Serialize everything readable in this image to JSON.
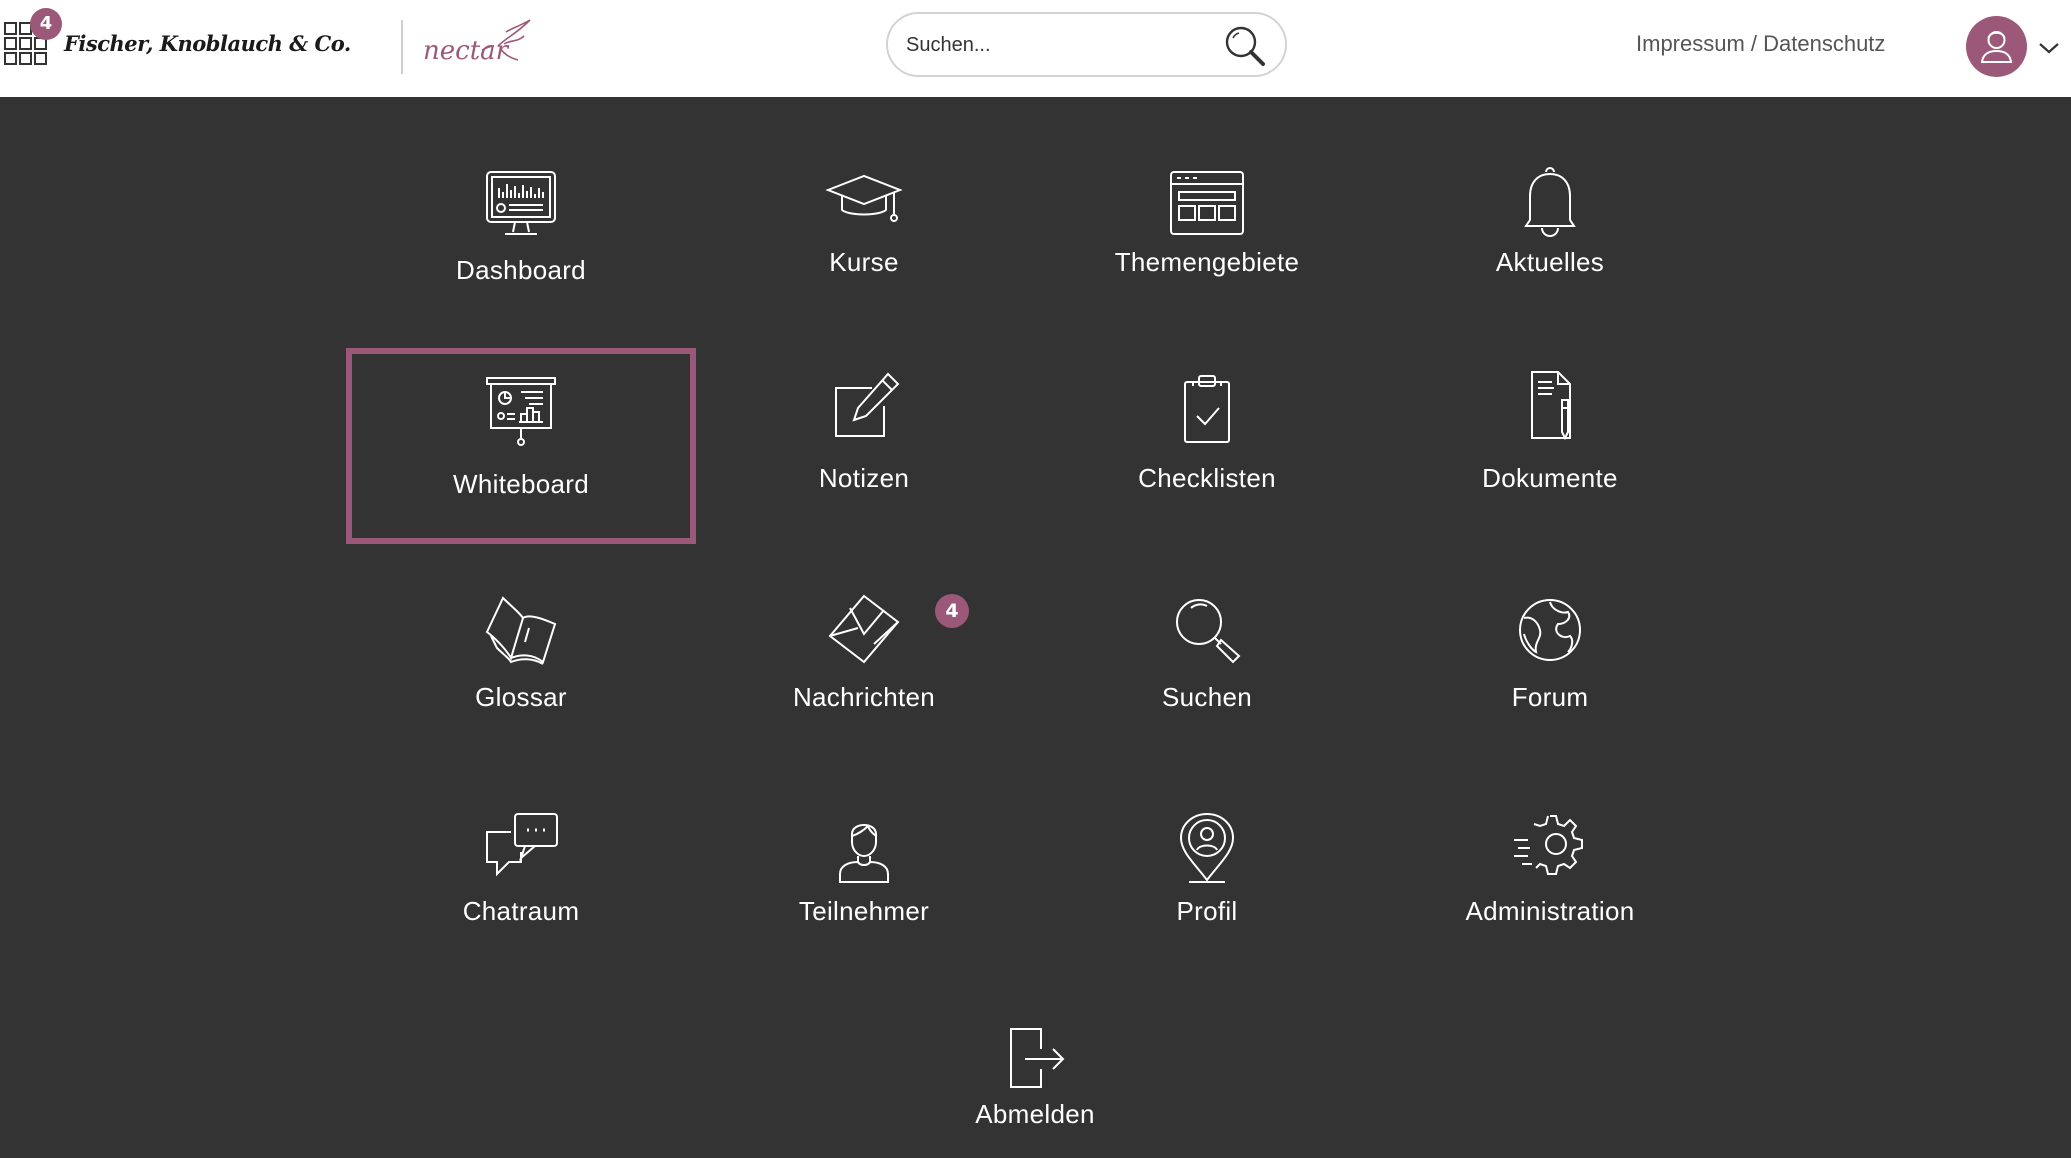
{
  "header": {
    "app_badge_count": "4",
    "brand_name": "Fischer, Knoblauch & Co.",
    "nectar_logo_text": "nectar",
    "search_placeholder": "Suchen...",
    "impressum_link": "Impressum / Datenschutz"
  },
  "tiles": [
    {
      "label": "Dashboard",
      "icon": "dashboard-monitor-icon"
    },
    {
      "label": "Kurse",
      "icon": "graduation-cap-icon"
    },
    {
      "label": "Themengebiete",
      "icon": "browser-window-icon"
    },
    {
      "label": "Aktuelles",
      "icon": "bell-icon"
    },
    {
      "label": "Whiteboard",
      "icon": "presentation-board-icon",
      "selected": true
    },
    {
      "label": "Notizen",
      "icon": "pencil-note-icon"
    },
    {
      "label": "Checklisten",
      "icon": "clipboard-check-icon"
    },
    {
      "label": "Dokumente",
      "icon": "document-pen-icon"
    },
    {
      "label": "Glossar",
      "icon": "open-book-icon"
    },
    {
      "label": "Nachrichten",
      "icon": "envelope-icon",
      "badge": "4"
    },
    {
      "label": "Suchen",
      "icon": "magnifier-icon"
    },
    {
      "label": "Forum",
      "icon": "globe-icon"
    },
    {
      "label": "Chatraum",
      "icon": "chat-bubbles-icon"
    },
    {
      "label": "Teilnehmer",
      "icon": "person-icon"
    },
    {
      "label": "Profil",
      "icon": "location-profile-icon"
    },
    {
      "label": "Administration",
      "icon": "gear-icon"
    },
    {
      "label": "Abmelden",
      "icon": "logout-door-icon"
    }
  ],
  "colors": {
    "accent": "#9c5878",
    "background": "#333333",
    "header_bg": "#ffffff"
  }
}
